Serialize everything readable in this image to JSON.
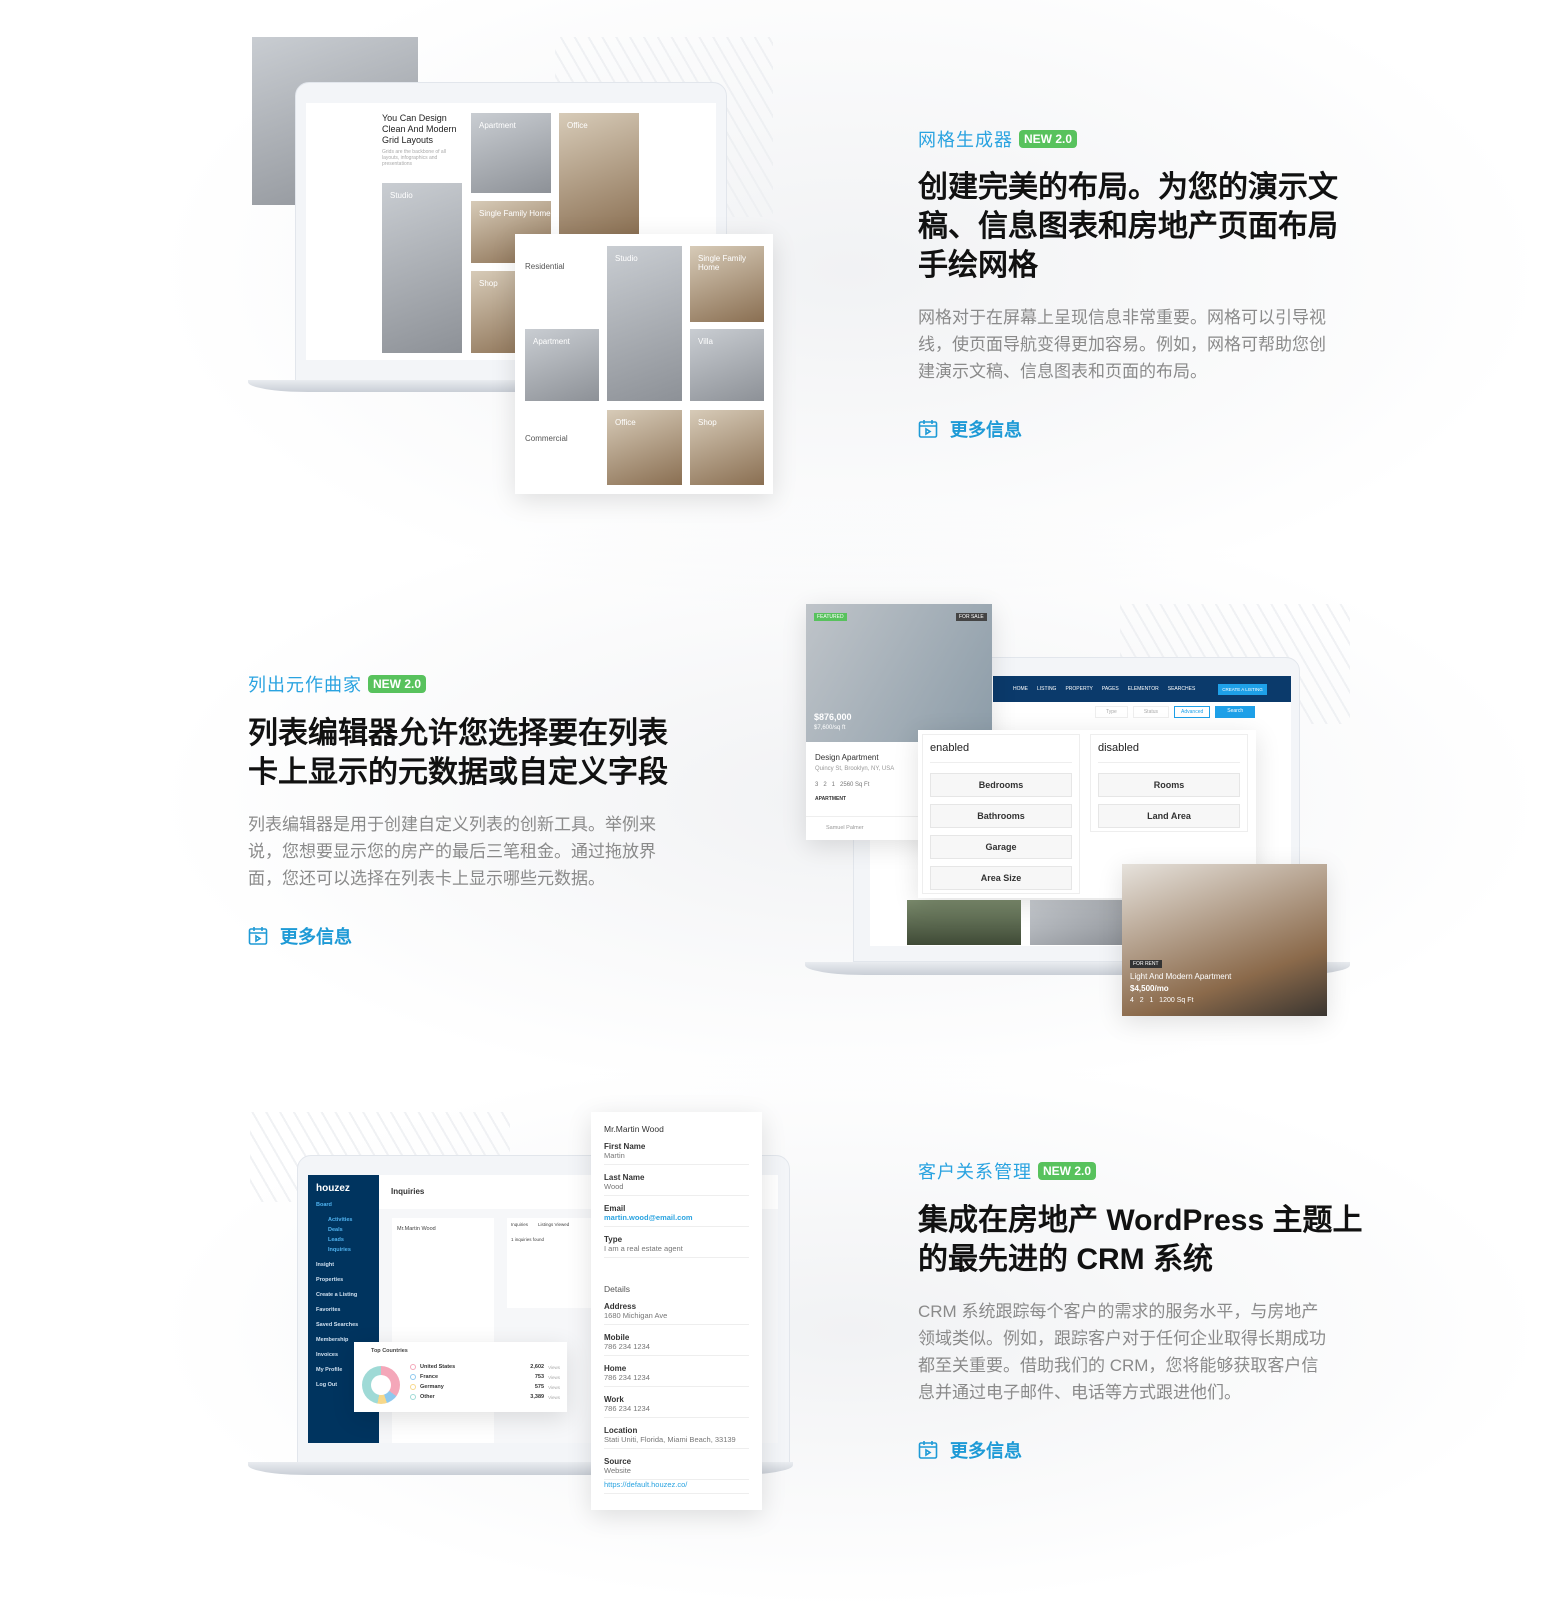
{
  "colors": {
    "accent": "#2aa3e0",
    "badge": "#58c25d",
    "heading": "#111111",
    "body": "#8a8a8a",
    "navy": "#0b3a6b"
  },
  "badge": "NEW 2.0",
  "more_info": "更多信息",
  "more_info_icon": "video-calendar-icon",
  "sections": [
    {
      "label": "网格生成器",
      "heading": [
        "创建完美的布局。为您的演示文",
        "稿、信息图表和房地产页面布局",
        "手绘网格"
      ],
      "body": [
        "网格对于在屏幕上呈现信息非常重要。网格可以引导视",
        "线，使页面导航变得更加容易。例如，网格可帮助您创",
        "建演示文稿、信息图表和页面的布局。"
      ]
    },
    {
      "label": "列出元作曲家",
      "heading": [
        "列表编辑器允许您选择要在列表",
        "卡上显示的元数据或自定义字段"
      ],
      "body": [
        "列表编辑器是用于创建自定义列表的创新工具。举例来",
        "说，您想要显示您的房产的最后三笔租金。通过拖放界",
        "面，您还可以选择在列表卡上显示哪些元数据。"
      ]
    },
    {
      "label": "客户关系管理",
      "heading": [
        "集成在房地产 WordPress 主题上",
        "的最先进的 CRM 系统"
      ],
      "body": [
        "CRM 系统跟踪每个客户的需求的服务水平，与房地产",
        "领域类似。例如，跟踪客户对于任何企业取得长期成功",
        "都至关重要。借助我们的 CRM，您将能够获取客户信",
        "息并通过电子邮件、电话等方式跟进他们。"
      ]
    }
  ],
  "mock1": {
    "title": "You Can Design Clean And Modern Grid Layouts",
    "sub": "Grids are the backbone of all layouts, infographics and presentations",
    "tiles": [
      "Apartment",
      "Office",
      "Studio",
      "Single Family Home",
      "Shop"
    ],
    "residential": "Residential",
    "commercial": "Commercial",
    "tiles2": [
      "Studio",
      "Single Family Home",
      "Apartment",
      "Villa",
      "Office",
      "Shop"
    ]
  },
  "mock2": {
    "featured": "FEATURED",
    "for_sale": "FOR SALE",
    "price": "$876,000",
    "price_sqft": "$7,600/sq ft",
    "title": "Design Apartment",
    "address": "Quincy St, Brooklyn, NY, USA",
    "meta": "3   2   1   2560 Sq Ft",
    "type": "APARTMENT",
    "agent": "Samuel Palmer",
    "nav": [
      "HOME",
      "LISTING",
      "PROPERTY",
      "PAGES",
      "ELEMENTOR",
      "SEARCHES"
    ],
    "create": "CREATE A LISTING",
    "search_fields": [
      "Type",
      "Status",
      "Advanced"
    ],
    "search": "Search",
    "enabled": "enabled",
    "disabled": "disabled",
    "enabled_items": [
      "Bedrooms",
      "Bathrooms",
      "Garage",
      "Area Size"
    ],
    "disabled_items": [
      "Rooms",
      "Land Area"
    ],
    "rent_badge": "FOR RENT",
    "rent_title": "Light And Modern Apartment",
    "rent_price": "$4,500/mo",
    "rent_meta": "4   2   1   1200 Sq Ft"
  },
  "mock3": {
    "logo": "houzez",
    "menu": [
      "Board",
      "Activities",
      "Deals",
      "Leads",
      "Inquiries",
      "Insight",
      "Properties",
      "Create a Listing",
      "Favorites",
      "Saved Searches",
      "Membership",
      "Invoices",
      "My Profile",
      "Log Out"
    ],
    "page": "Inquiries",
    "tabs": [
      "Inquiries",
      "Listings Viewed"
    ],
    "found": "1 inquiries found",
    "countries_title": "Top Countries",
    "countries": [
      {
        "name": "United States",
        "views": "2,602",
        "color": "#f4a7b9"
      },
      {
        "name": "France",
        "views": "753",
        "color": "#8ec9ee"
      },
      {
        "name": "Germany",
        "views": "575",
        "color": "#f7d88a"
      },
      {
        "name": "Other",
        "views": "3,389",
        "color": "#9fdad6"
      }
    ],
    "views": "Views",
    "contact_name": "Mr.Martin Wood",
    "fields": [
      {
        "k": "First Name",
        "v": "Martin"
      },
      {
        "k": "Last Name",
        "v": "Wood"
      },
      {
        "k": "Email",
        "v": "martin.wood@email.com"
      },
      {
        "k": "Type",
        "v": "I am a real estate agent"
      }
    ],
    "details": "Details",
    "details_fields": [
      {
        "k": "Address",
        "v": "1680 Michigan Ave"
      },
      {
        "k": "Mobile",
        "v": "786 234 1234"
      },
      {
        "k": "Home",
        "v": "786 234 1234"
      },
      {
        "k": "Work",
        "v": "786 234 1234"
      },
      {
        "k": "Location",
        "v": "Stati Uniti, Florida, Miami Beach, 33139"
      },
      {
        "k": "Source",
        "v": "Website"
      }
    ],
    "source_link": "https://default.houzez.co/"
  }
}
